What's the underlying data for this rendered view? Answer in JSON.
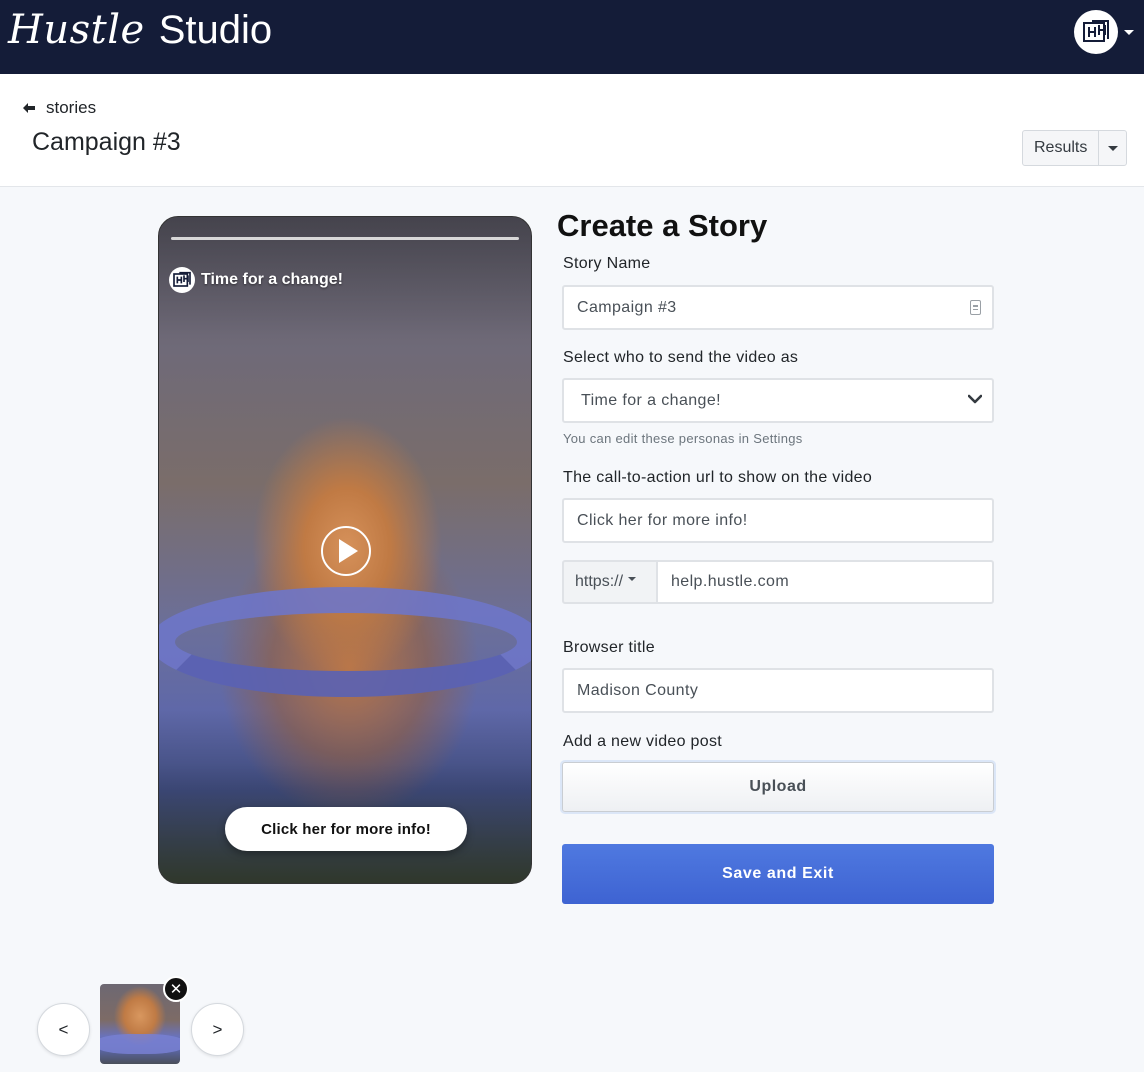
{
  "nav": {
    "brand_script": "Hustle",
    "brand_word": "Studio",
    "avatar_icon": "hustle-logo-icon"
  },
  "header": {
    "back_label": "stories",
    "title": "Campaign #3",
    "results_label": "Results"
  },
  "preview": {
    "persona_name": "Time for a change!",
    "cta_text": "Click her for more info!",
    "progress": 1.0
  },
  "form": {
    "heading": "Create a Story",
    "story_name_label": "Story Name",
    "story_name_value": "Campaign #3",
    "persona_label": "Select who to send the video as",
    "persona_value": "Time for a change!",
    "persona_help": "You can edit these personas in Settings",
    "cta_label": "The call-to-action url to show on the video",
    "cta_text_value": "Click her for more info!",
    "url_prefix": "https://",
    "url_value": "help.hustle.com",
    "browser_title_label": "Browser title",
    "browser_title_value": "Madison County",
    "upload_label": "Add a new video post",
    "upload_button": "Upload",
    "save_button": "Save and Exit"
  },
  "carousel": {
    "prev_label": "<",
    "next_label": ">",
    "remove_label": "✕"
  },
  "colors": {
    "nav_bg": "#141c38",
    "primary": "#4468d8"
  }
}
